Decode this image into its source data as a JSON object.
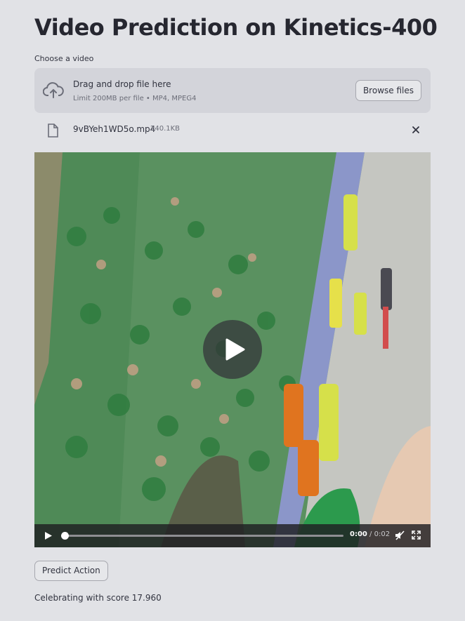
{
  "page": {
    "title": "Video Prediction on Kinetics-400"
  },
  "uploader": {
    "label": "Choose a video",
    "drop_title": "Drag and drop file here",
    "limit_text": "Limit 200MB per file • MP4, MPEG4",
    "browse_label": "Browse files",
    "icon": "cloud-upload-icon"
  },
  "file": {
    "name": "9vBYeh1WD5o.mp4",
    "size": "240.1KB",
    "icon": "file-icon",
    "remove_icon": "close-icon"
  },
  "video": {
    "current_time": "0:00",
    "separator": " / ",
    "duration": "0:02",
    "progress": 0.0,
    "muted": true,
    "icons": [
      "play-icon",
      "mute-icon",
      "fullscreen-icon"
    ]
  },
  "actions": {
    "predict_label": "Predict Action"
  },
  "result": {
    "text": "Celebrating with score 17.960"
  },
  "colors": {
    "background": "#e1e2e6",
    "dropzone": "#d3d4da",
    "text": "#31333f",
    "controls_bar": "#1e1e22"
  }
}
